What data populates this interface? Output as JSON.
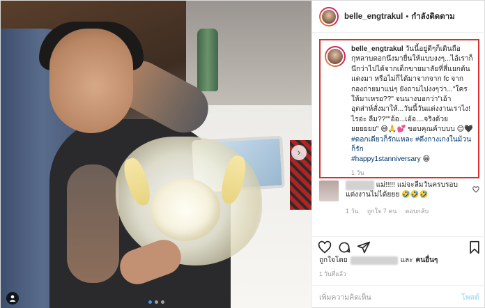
{
  "header": {
    "username": "belle_engtrakul",
    "separator": "•",
    "follow_label": "กำลังติดตาม"
  },
  "caption": {
    "username": "belle_engtrakul",
    "text": " วันนี้อยู่ดีๆก็เดินถือกุหลาบดอกนึงมายื่นให้แบบงงๆ...ไอ้เราก็นึกว่าไปได้จากเด็กขายมาลัยที่สี่แยกต้นแดงมา หรือไม่ก็ได้มาจากจาก fc จากกองถ่ายมาแน่ๆ ยังถามไปงงๆว่า...\"ใครให้มาเหรอ??\" จนนางบอกว่า\"เอ้า อุตส่าห์สั่งมาให้...วันนี้วันแต่งงานเราไง!ไรอ่ะ ลืม??\"\"อ้อ...เอ้อ....จริงด้วยยยยยยย\" 😅🙏💕 ขอบคุณค้าบบบ 😊🖤",
    "hashtags": "#ดอกเดียวก็รักแหละ #ดึงกางเกงในม้วนก็รัก",
    "anniversary": "#happy1stanniversary",
    "emoji_end": " 😁",
    "time": "1 วัน"
  },
  "comment": {
    "blurred_name": "xxxxxxxx",
    "text": " แม่!!!!! แม่จะลืมวันครบรอบแต่งงานไม่ได้ยยย 🤣🤣🤣",
    "time": "1 วัน",
    "likes": "ถูกใจ 7 คน",
    "reply": "ตอบกลับ"
  },
  "likes": {
    "prefix": "ถูกใจโดย",
    "suffix": "และ",
    "others": "คนอื่นๆ"
  },
  "date": "1 วันที่แล้ว",
  "add_comment": {
    "placeholder": "เพิ่มความคิดเห็น",
    "post_label": "โพสต์"
  },
  "photo": {
    "next": "›",
    "slides": 3,
    "active_slide": 1
  },
  "colors": {
    "highlight_border": "#d92f2f",
    "hashtag": "#003569",
    "post_button_disabled": "#b2dffc",
    "carousel_active": "#3897f0"
  }
}
